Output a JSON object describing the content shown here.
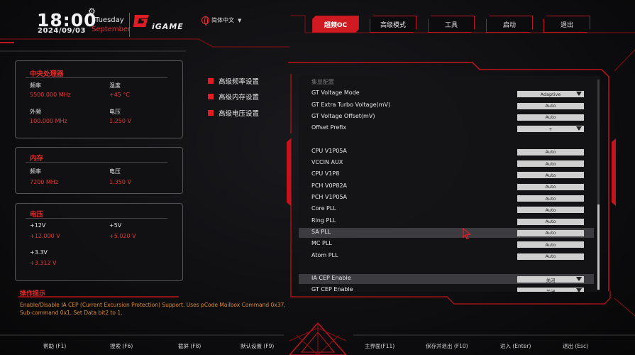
{
  "header": {
    "time": "18:00",
    "date": "2024/09/03",
    "day": "Tuesday",
    "month": "September",
    "brand": "iGAME",
    "language": "简体中文"
  },
  "nav": [
    "超频OC",
    "高级模式",
    "工具",
    "启动",
    "退出"
  ],
  "nav_active": 0,
  "cpu": {
    "title": "中央处理器",
    "freq_label": "频率",
    "freq_value": "5500.000 MHz",
    "temp_label": "温度",
    "temp_value": "+45 °C",
    "bclk_label": "外频",
    "bclk_value": "100.000 MHz",
    "volt_label": "电压",
    "volt_value": "1.250 V"
  },
  "memory": {
    "title": "内存",
    "freq_label": "频率",
    "freq_value": "7200 MHz",
    "volt_label": "电压",
    "volt_value": "1.350 V"
  },
  "voltage": {
    "title": "电压",
    "v12_label": "+12V",
    "v12_value": "+12.000 V",
    "v5_label": "+5V",
    "v5_value": "+5.020 V",
    "v33_label": "+3.3V",
    "v33_value": "+3.312 V"
  },
  "submenu": [
    "高级频率设置",
    "高级内存设置",
    "高级电压设置"
  ],
  "settings": [
    {
      "name": "集显配置",
      "value": "",
      "dim": true
    },
    {
      "name": "GT Voltage Mode",
      "value": "Adaptive",
      "dropdown": true
    },
    {
      "name": "GT Extra Turbo Voltage(mV)",
      "value": "Auto"
    },
    {
      "name": "GT Voltage Offset(mV)",
      "value": "Auto"
    },
    {
      "name": "Offset Prefix",
      "value": "+",
      "dropdown": true
    },
    {
      "name": "",
      "value": ""
    },
    {
      "name": "CPU V1P05A",
      "value": "Auto"
    },
    {
      "name": "VCCIN AUX",
      "value": "Auto"
    },
    {
      "name": "CPU V1P8",
      "value": "Auto"
    },
    {
      "name": "PCH V0P82A",
      "value": "Auto"
    },
    {
      "name": "PCH V1P05A",
      "value": "Auto"
    },
    {
      "name": "Core PLL",
      "value": "Auto"
    },
    {
      "name": "Ring PLL",
      "value": "Auto"
    },
    {
      "name": "SA PLL",
      "value": "Auto",
      "highlight": true
    },
    {
      "name": "MC PLL",
      "value": "Auto"
    },
    {
      "name": "Atom PLL",
      "value": "Auto"
    },
    {
      "name": "",
      "value": ""
    },
    {
      "name": "IA CEP Enable",
      "value": "关闭",
      "dropdown": true,
      "highlight": true
    },
    {
      "name": "GT CEP Enable",
      "value": "关闭",
      "dropdown": true
    }
  ],
  "help": {
    "title": "操作提示",
    "text": "Enable/Disable IA CEP (Current Excursion Protection) Support. Uses pCode Mailbox Command 0x37, Sub-command 0x1. Set Data bit2 to 1."
  },
  "footer": {
    "help": "帮助 (F1)",
    "search": "搜索 (F6)",
    "screenshot": "截屏 (F8)",
    "defaults": "默认设置 (F9)",
    "main": "主界面(F11)",
    "save_exit": "保存并退出 (F10)",
    "enter": "进入 (Enter)",
    "exit": "退出 (Esc)"
  },
  "colors": {
    "accent": "#d01a22",
    "value": "#e03a3a",
    "help": "#d98a2a"
  }
}
